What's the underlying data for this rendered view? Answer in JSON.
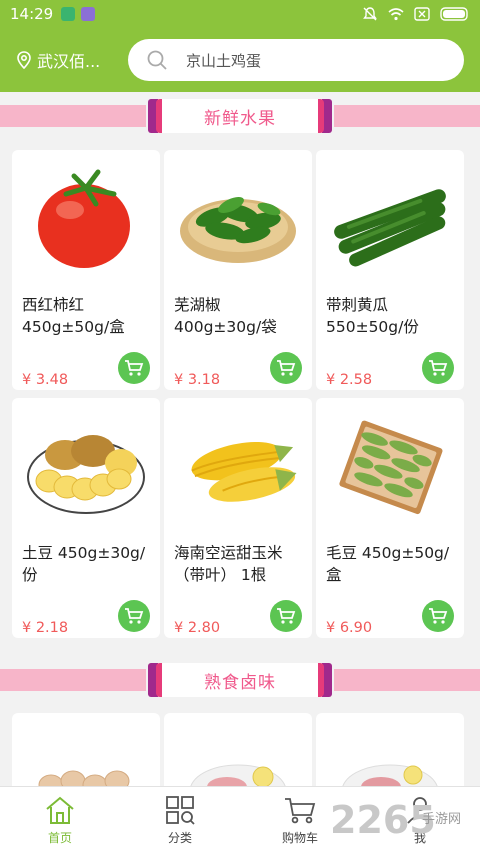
{
  "status_bar": {
    "time": "14:29"
  },
  "header": {
    "location": "武汉佰...",
    "search_placeholder": "京山土鸡蛋"
  },
  "sections": [
    {
      "title": "新鲜水果"
    },
    {
      "title": "熟食卤味"
    }
  ],
  "products": [
    {
      "name": "西红柿红 450g±50g/盒",
      "price": "¥ 3.48"
    },
    {
      "name": "芜湖椒 400g±30g/袋",
      "price": "¥ 3.18"
    },
    {
      "name": "带刺黄瓜 550±50g/份",
      "price": "¥ 2.58"
    },
    {
      "name": "土豆 450g±30g/份",
      "price": "¥ 2.18"
    },
    {
      "name": "海南空运甜玉米（带叶） 1根",
      "price": "¥ 2.80"
    },
    {
      "name": "毛豆 450g±50g/盒",
      "price": "¥ 6.90"
    }
  ],
  "bottom_nav": [
    {
      "label": "首页",
      "icon": "home-icon",
      "active": true
    },
    {
      "label": "分类",
      "icon": "category-icon",
      "active": false
    },
    {
      "label": "购物车",
      "icon": "cart-icon",
      "active": false
    },
    {
      "label": "我",
      "icon": "user-icon",
      "active": false
    }
  ],
  "watermark": {
    "text": "2265",
    "sub": "手游网"
  },
  "colors": {
    "header_green": "#8cc43c",
    "price_red": "#f05a5a",
    "cart_green": "#5cc552",
    "banner_pink": "#f7b5c9",
    "nav_active": "#7cbb36"
  }
}
